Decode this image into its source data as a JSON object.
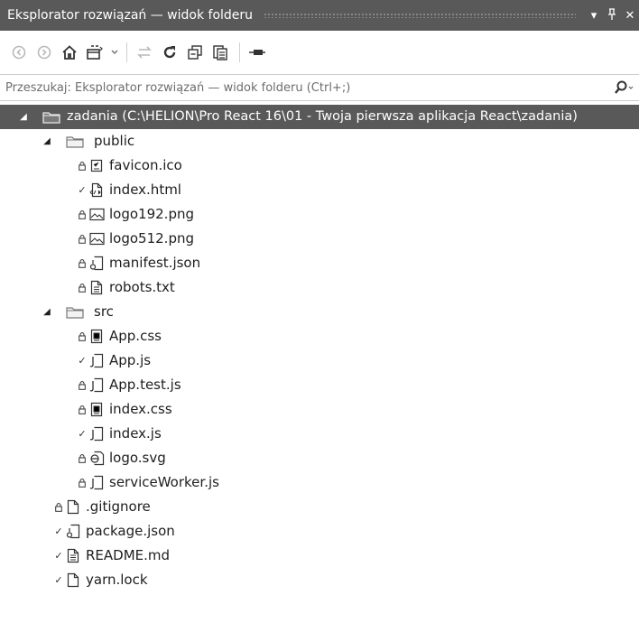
{
  "window": {
    "title": "Eksplorator rozwiązań — widok folderu",
    "dropdown_glyph": "▾",
    "pin_glyph": "ꟼ",
    "close_glyph": "✕"
  },
  "toolbar": {
    "icons": [
      "back-icon",
      "forward-icon",
      "home-icon",
      "switch-views-icon",
      "dropdown-icon",
      "sync-icon",
      "refresh-icon",
      "collapse-all-icon",
      "show-all-files-icon",
      "properties-icon"
    ]
  },
  "search": {
    "placeholder": "Przeszukaj: Eksplorator rozwiązań — widok folderu (Ctrl+;)"
  },
  "tree": {
    "root": {
      "label": "zadania (C:\\HELION\\Pro React 16\\01 - Twoja pierwsza aplikacja React\\zadania)"
    },
    "public": {
      "label": "public",
      "files": [
        {
          "name": "favicon.ico",
          "status": "lock",
          "icon": "ico-file-icon"
        },
        {
          "name": "index.html",
          "status": "check",
          "icon": "html-file-icon"
        },
        {
          "name": "logo192.png",
          "status": "lock",
          "icon": "image-file-icon"
        },
        {
          "name": "logo512.png",
          "status": "lock",
          "icon": "image-file-icon"
        },
        {
          "name": "manifest.json",
          "status": "lock",
          "icon": "json-file-icon"
        },
        {
          "name": "robots.txt",
          "status": "lock",
          "icon": "text-file-icon"
        }
      ]
    },
    "src": {
      "label": "src",
      "files": [
        {
          "name": "App.css",
          "status": "lock",
          "icon": "css-file-icon"
        },
        {
          "name": "App.js",
          "status": "check",
          "icon": "js-file-icon"
        },
        {
          "name": "App.test.js",
          "status": "lock",
          "icon": "js-file-icon"
        },
        {
          "name": "index.css",
          "status": "lock",
          "icon": "css-file-icon"
        },
        {
          "name": "index.js",
          "status": "check",
          "icon": "js-file-icon"
        },
        {
          "name": "logo.svg",
          "status": "lock",
          "icon": "svg-file-icon"
        },
        {
          "name": "serviceWorker.js",
          "status": "lock",
          "icon": "js-file-icon"
        }
      ]
    },
    "root_files": [
      {
        "name": ".gitignore",
        "status": "lock",
        "icon": "blank-file-icon"
      },
      {
        "name": "package.json",
        "status": "check",
        "icon": "json-file-icon"
      },
      {
        "name": "README.md",
        "status": "check",
        "icon": "text-file-icon"
      },
      {
        "name": "yarn.lock",
        "status": "check",
        "icon": "blank-file-icon"
      }
    ]
  }
}
